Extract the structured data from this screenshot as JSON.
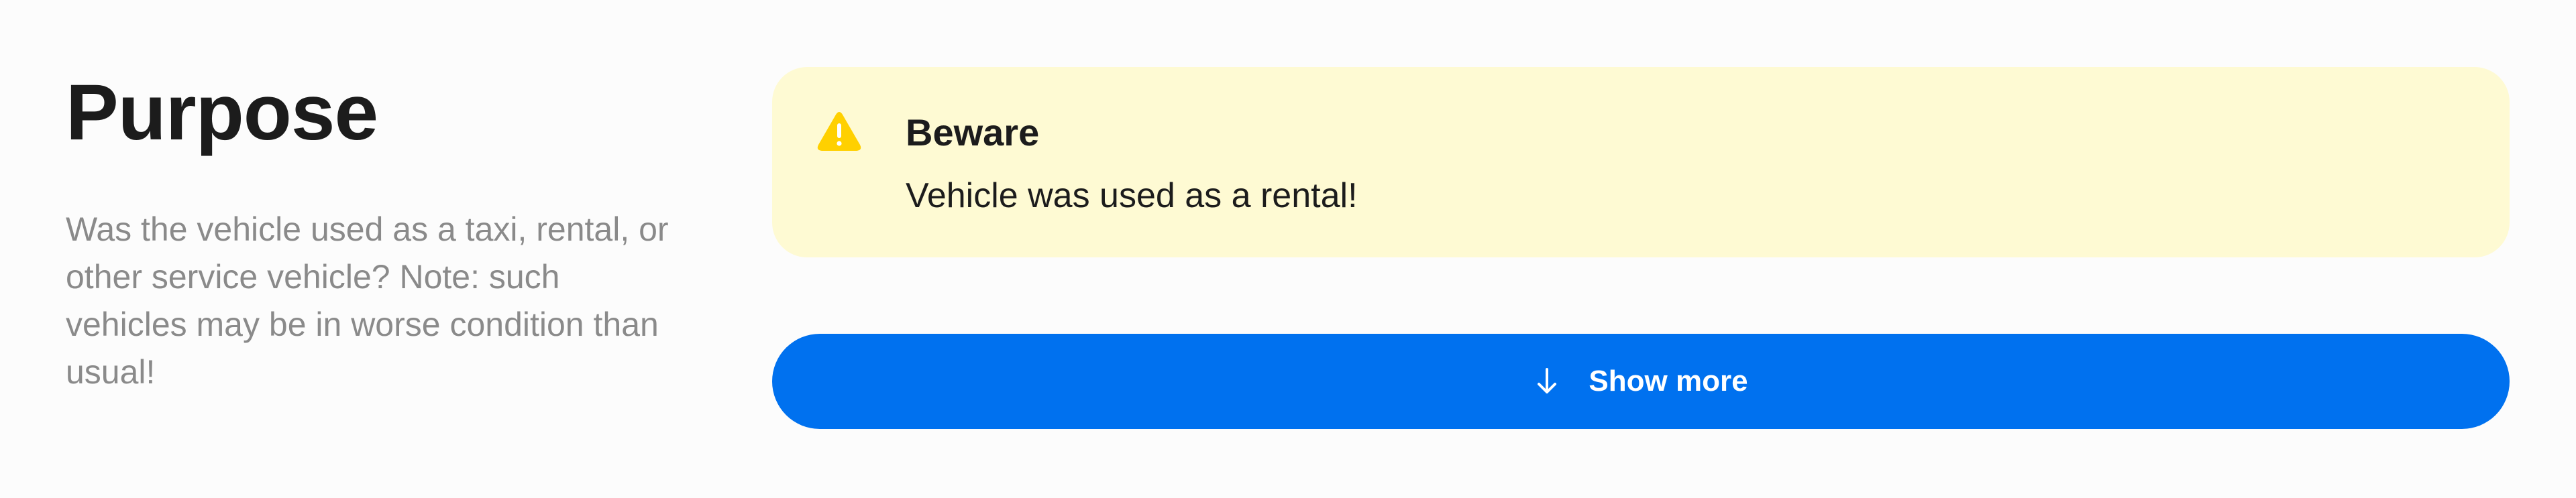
{
  "section": {
    "title": "Purpose",
    "description": "Was the vehicle used as a taxi, rental, or other service vehicle? Note: such vehicles may be in worse condition than usual!"
  },
  "alert": {
    "icon": "warning-triangle-icon",
    "title": "Beware",
    "message": "Vehicle was used as a rental!"
  },
  "show_more": {
    "icon": "arrow-down-icon",
    "label": "Show more"
  },
  "colors": {
    "alert_background": "#fefad3",
    "warning_icon": "#ffd000",
    "button_background": "#0071ef",
    "button_text": "#ffffff",
    "heading": "#1c1c1c",
    "muted_text": "#8a8a8a"
  }
}
